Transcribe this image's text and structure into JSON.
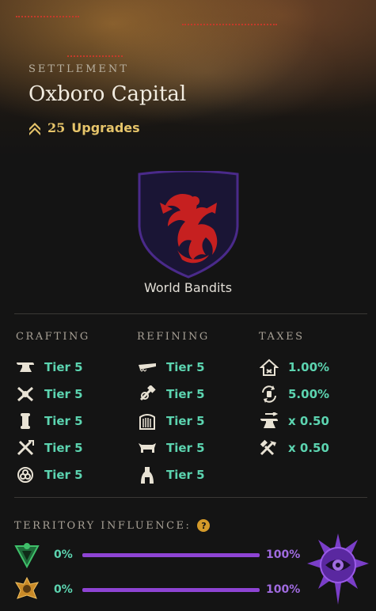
{
  "header": {
    "kicker": "SETTLEMENT",
    "name": "Oxboro Capital",
    "upgrades_count": "25",
    "upgrades_label": "Upgrades"
  },
  "faction": {
    "name": "World Bandits"
  },
  "crafting": {
    "heading": "CRAFTING",
    "items": [
      {
        "icon": "anvil-icon",
        "value": "Tier 5"
      },
      {
        "icon": "crossed-tools-icon",
        "value": "Tier 5"
      },
      {
        "icon": "scroll-icon",
        "value": "Tier 5"
      },
      {
        "icon": "crossed-swords-icon",
        "value": "Tier 5"
      },
      {
        "icon": "ring-icon",
        "value": "Tier 5"
      }
    ]
  },
  "refining": {
    "heading": "REFINING",
    "items": [
      {
        "icon": "saw-icon",
        "value": "Tier 5"
      },
      {
        "icon": "hammer-icon",
        "value": "Tier 5"
      },
      {
        "icon": "loom-icon",
        "value": "Tier 5"
      },
      {
        "icon": "ox-icon",
        "value": "Tier 5"
      },
      {
        "icon": "furnace-icon",
        "value": "Tier 5"
      }
    ]
  },
  "taxes": {
    "heading": "TAXES",
    "items": [
      {
        "icon": "house-tax-icon",
        "value": "1.00%"
      },
      {
        "icon": "trade-cycle-icon",
        "value": "5.00%"
      },
      {
        "icon": "anvil-fee-icon",
        "value": "x 0.50"
      },
      {
        "icon": "tools-fee-icon",
        "value": "x 0.50"
      }
    ]
  },
  "influence": {
    "heading": "TERRITORY INFLUENCE:",
    "help": "?",
    "rows": [
      {
        "faction": "green-faction-icon",
        "left": "0%",
        "right": "100%",
        "fill": 1.0
      },
      {
        "faction": "gold-faction-icon",
        "left": "0%",
        "right": "100%",
        "fill": 1.0
      }
    ]
  },
  "colors": {
    "accent_teal": "#5cd4b0",
    "gold": "#e6c46a",
    "purple": "#8e44d4",
    "shield_red": "#c62020"
  }
}
